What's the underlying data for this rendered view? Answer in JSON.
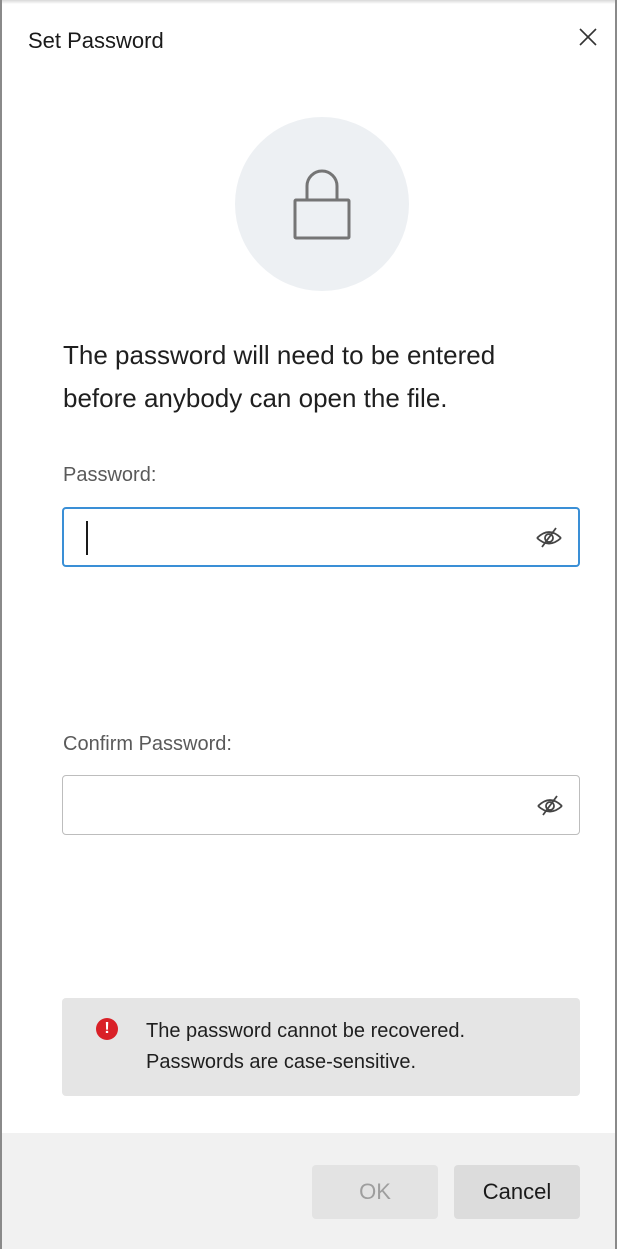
{
  "dialog": {
    "title": "Set Password",
    "close_icon": "close-icon"
  },
  "lock": {
    "icon": "lock-icon",
    "circle_color": "#edf0f3"
  },
  "message": {
    "line1": "The password will need to be entered",
    "line2": "before anybody can open the file."
  },
  "password_field": {
    "label": "Password:",
    "value": "",
    "focused": true,
    "visibility_icon": "eye-hidden-icon",
    "focus_color": "#3a8fd6"
  },
  "confirm_field": {
    "label": "Confirm Password:",
    "value": "",
    "visibility_icon": "eye-hidden-icon"
  },
  "warning": {
    "icon": "error-icon",
    "icon_glyph": "!",
    "icon_color": "#d92027",
    "line1": "The password cannot be recovered.",
    "line2": "Passwords are case-sensitive."
  },
  "buttons": {
    "ok_label": "OK",
    "ok_enabled": false,
    "cancel_label": "Cancel"
  }
}
